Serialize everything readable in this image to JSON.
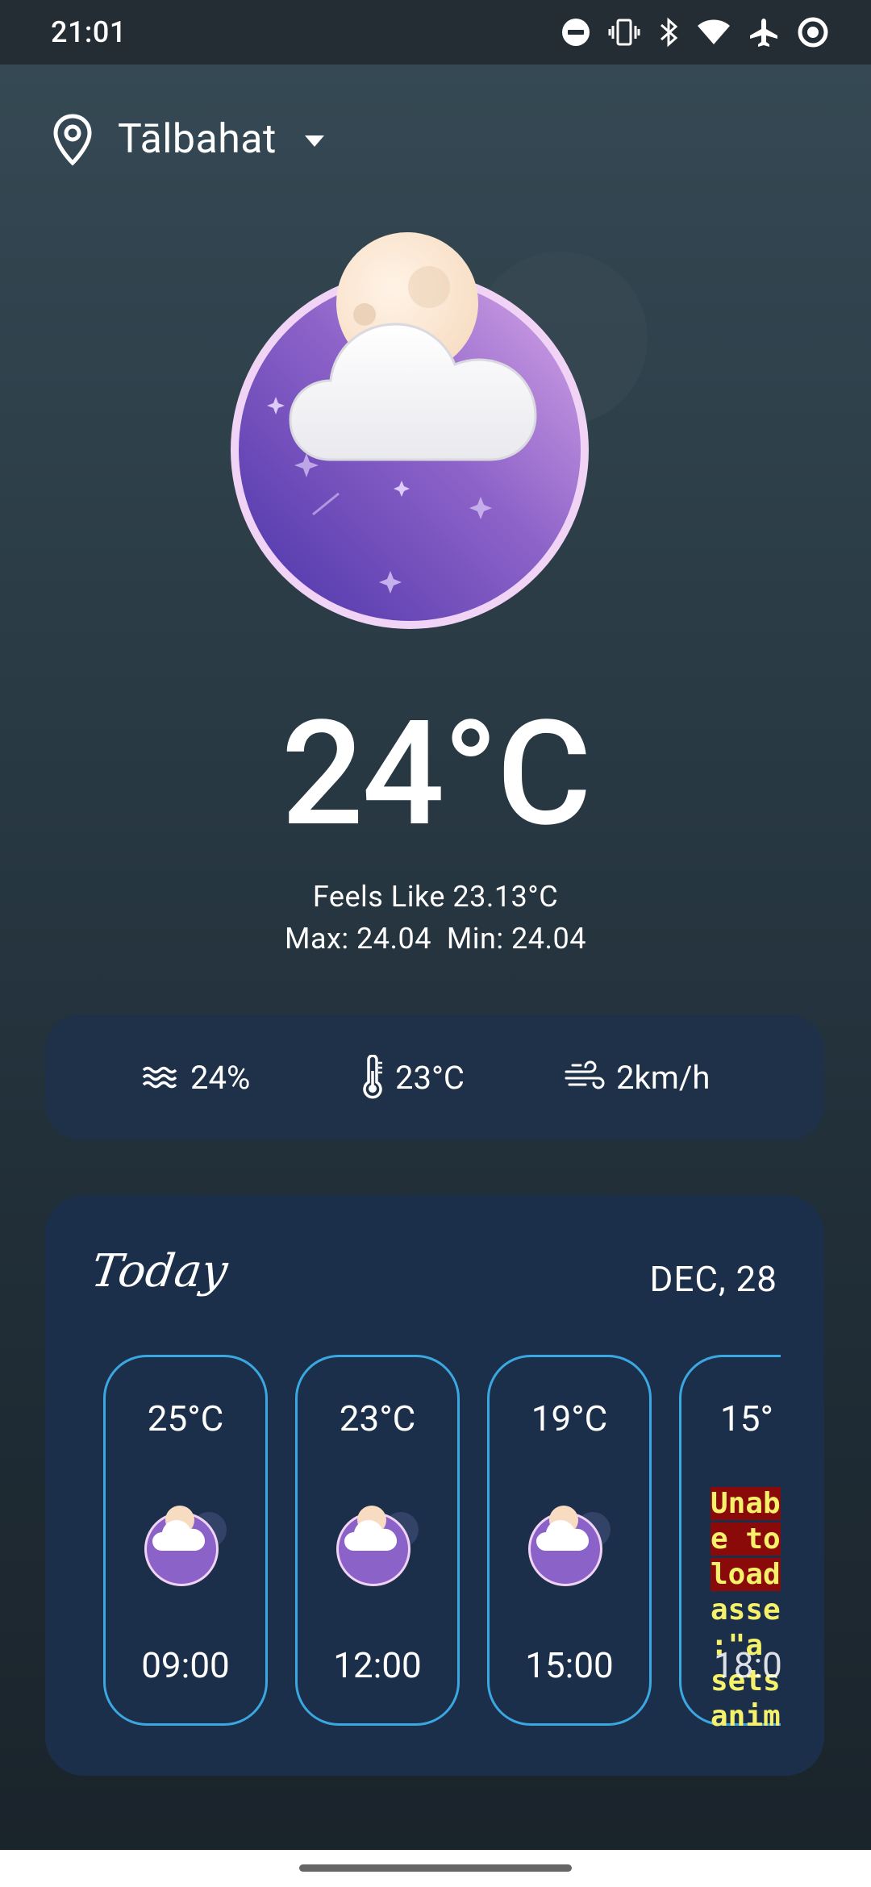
{
  "status_bar": {
    "time": "21:01",
    "icons": [
      "do-not-disturb-icon",
      "vibrate-icon",
      "bluetooth-icon",
      "wifi-icon",
      "airplane-icon",
      "data-saver-icon"
    ]
  },
  "location": {
    "name": "Tālbahat",
    "icon": "location-pin-icon"
  },
  "weather": {
    "condition_icon": "night-cloudy-icon",
    "temperature": "24°C",
    "feels_like": "Feels Like 23.13°C",
    "max_min": "Max: 24.04  Min: 24.04"
  },
  "stats": {
    "humidity": "24%",
    "temp": "23°C",
    "wind": "2km/h"
  },
  "today": {
    "title": "Today",
    "date": "DEC, 28",
    "hours": [
      {
        "temp": "25°C",
        "time": "09:00"
      },
      {
        "temp": "23°C",
        "time": "12:00"
      },
      {
        "temp": "19°C",
        "time": "15:00"
      },
      {
        "temp": "15°",
        "time": "18:0"
      }
    ],
    "error_text": [
      "Unab",
      "e to",
      "load",
      "asse",
      ":\"a",
      "sets",
      "anim"
    ]
  },
  "colors": {
    "accent_border": "#3aa7e0",
    "card_bg": "#1c2f4a"
  }
}
